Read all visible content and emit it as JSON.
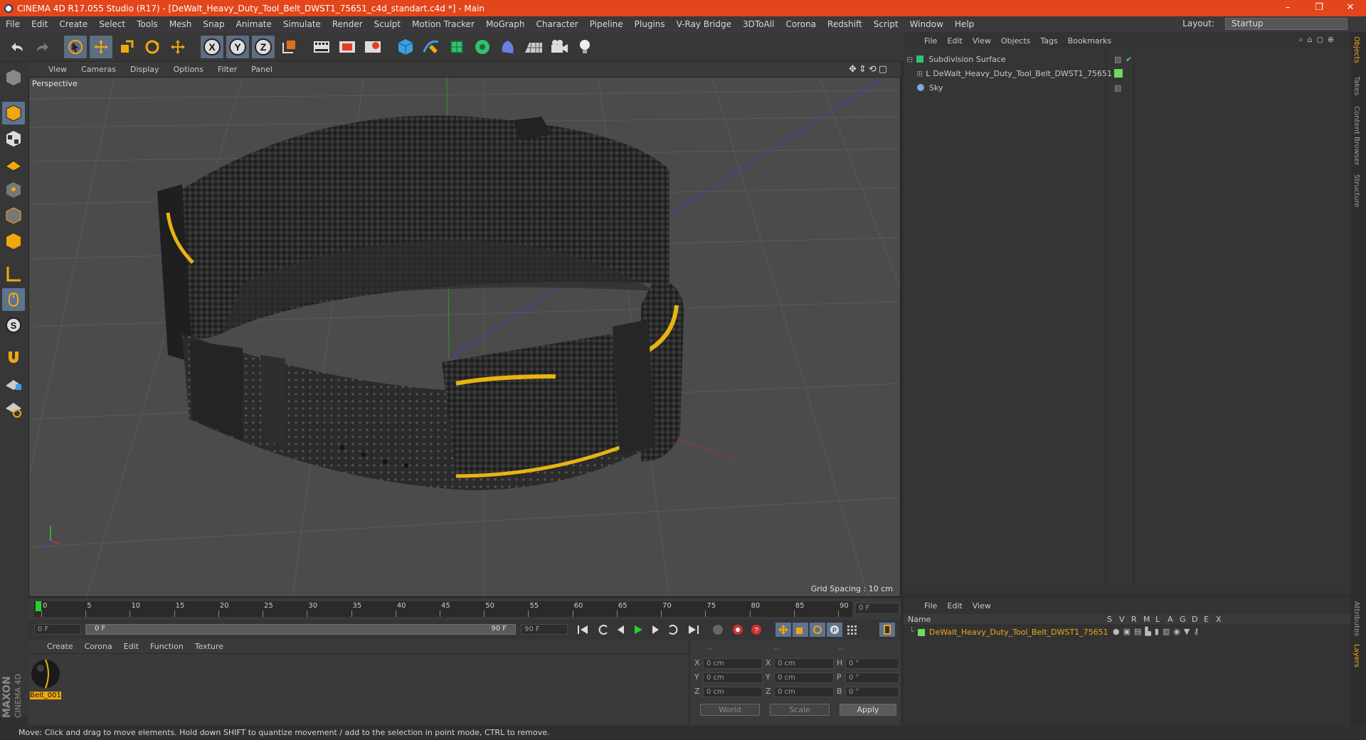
{
  "window": {
    "title": "CINEMA 4D R17.055 Studio (R17) - [DeWalt_Heavy_Duty_Tool_Belt_DWST1_75651_c4d_standart.c4d *] - Main",
    "minimize": "–",
    "restore": "❐",
    "close": "✕"
  },
  "menu": [
    "File",
    "Edit",
    "Create",
    "Select",
    "Tools",
    "Mesh",
    "Snap",
    "Animate",
    "Simulate",
    "Render",
    "Sculpt",
    "Motion Tracker",
    "MoGraph",
    "Character",
    "Pipeline",
    "Plugins",
    "V-Ray Bridge",
    "3DToAll",
    "Corona",
    "Redshift",
    "Script",
    "Window",
    "Help"
  ],
  "layout": {
    "label": "Layout:",
    "value": "Startup"
  },
  "toolbar_icons": [
    "undo-icon",
    "redo-icon",
    "select-arrow-icon",
    "move-icon",
    "scale-icon",
    "rotate-icon",
    "move-alt-icon",
    "x-axis-icon",
    "y-axis-icon",
    "z-axis-icon",
    "world-coord-icon",
    "render-view-icon",
    "render-region-icon",
    "render-settings-icon",
    "cube-icon",
    "spline-pen-icon",
    "subdivision-icon",
    "array-icon",
    "deformer-icon",
    "floor-icon",
    "camera-icon",
    "light-icon"
  ],
  "axis_letters": {
    "x": "X",
    "y": "Y",
    "z": "Z"
  },
  "left_tools": [
    "model-icon",
    "texture-icon",
    "workplane-icon",
    "points-icon",
    "edges-icon",
    "polygons-icon",
    "axis-icon",
    "tweak-icon",
    "solo-icon",
    "magnet-icon",
    "lock-grid-icon",
    "snap-icon"
  ],
  "viewport": {
    "menu": [
      "View",
      "Cameras",
      "Display",
      "Options",
      "Filter",
      "Panel"
    ],
    "label": "Perspective",
    "grid_spacing": "Grid Spacing : 10 cm"
  },
  "timeline": {
    "ticks": [
      "0",
      "5",
      "10",
      "15",
      "20",
      "25",
      "30",
      "35",
      "40",
      "45",
      "50",
      "55",
      "60",
      "65",
      "70",
      "75",
      "80",
      "85",
      "90"
    ],
    "frame_field": "0 F"
  },
  "transport": {
    "start": "0 F",
    "range_start": "0 F",
    "range_end": "90 F",
    "end": "90 F"
  },
  "materials": {
    "menu": [
      "Create",
      "Corona",
      "Edit",
      "Function",
      "Texture"
    ],
    "items": [
      {
        "name": "Belt_001"
      }
    ]
  },
  "coords": {
    "headers": [
      "--",
      "--",
      "--"
    ],
    "rows": [
      {
        "a": "X",
        "av": "0 cm",
        "b": "X",
        "bv": "0 cm",
        "c": "H",
        "cv": "0 °"
      },
      {
        "a": "Y",
        "av": "0 cm",
        "b": "Y",
        "bv": "0 cm",
        "c": "P",
        "cv": "0 °"
      },
      {
        "a": "Z",
        "av": "0 cm",
        "b": "Z",
        "bv": "0 cm",
        "c": "B",
        "cv": "0 °"
      }
    ],
    "mode1": "World",
    "mode2": "Scale",
    "apply": "Apply"
  },
  "objects": {
    "menu": [
      "File",
      "Edit",
      "View",
      "Objects",
      "Tags",
      "Bookmarks"
    ],
    "items": [
      {
        "name": "Subdivision Surface"
      },
      {
        "name": "DeWalt_Heavy_Duty_Tool_Belt_DWST1_75651"
      },
      {
        "name": "Sky"
      }
    ]
  },
  "layers": {
    "menu": [
      "File",
      "Edit",
      "View"
    ],
    "headers": {
      "name": "Name",
      "cols": [
        "S",
        "V",
        "R",
        "M",
        "L",
        "A",
        "G",
        "D",
        "E",
        "X"
      ]
    },
    "items": [
      {
        "name": "DeWalt_Heavy_Duty_Tool_Belt_DWST1_75651"
      }
    ]
  },
  "side_tabs": [
    "Objects",
    "Takes",
    "Content Browser",
    "Structure",
    "Attributes",
    "Layers"
  ],
  "maxon": {
    "a": "MAXON",
    "b": "CINEMA 4D"
  },
  "status": "Move: Click and drag to move elements. Hold down SHIFT to quantize movement / add to the selection in point mode, CTRL to remove.",
  "colors": {
    "accent": "#e2461a",
    "highlight": "#f0a810",
    "layer_green": "#6adc5e"
  }
}
